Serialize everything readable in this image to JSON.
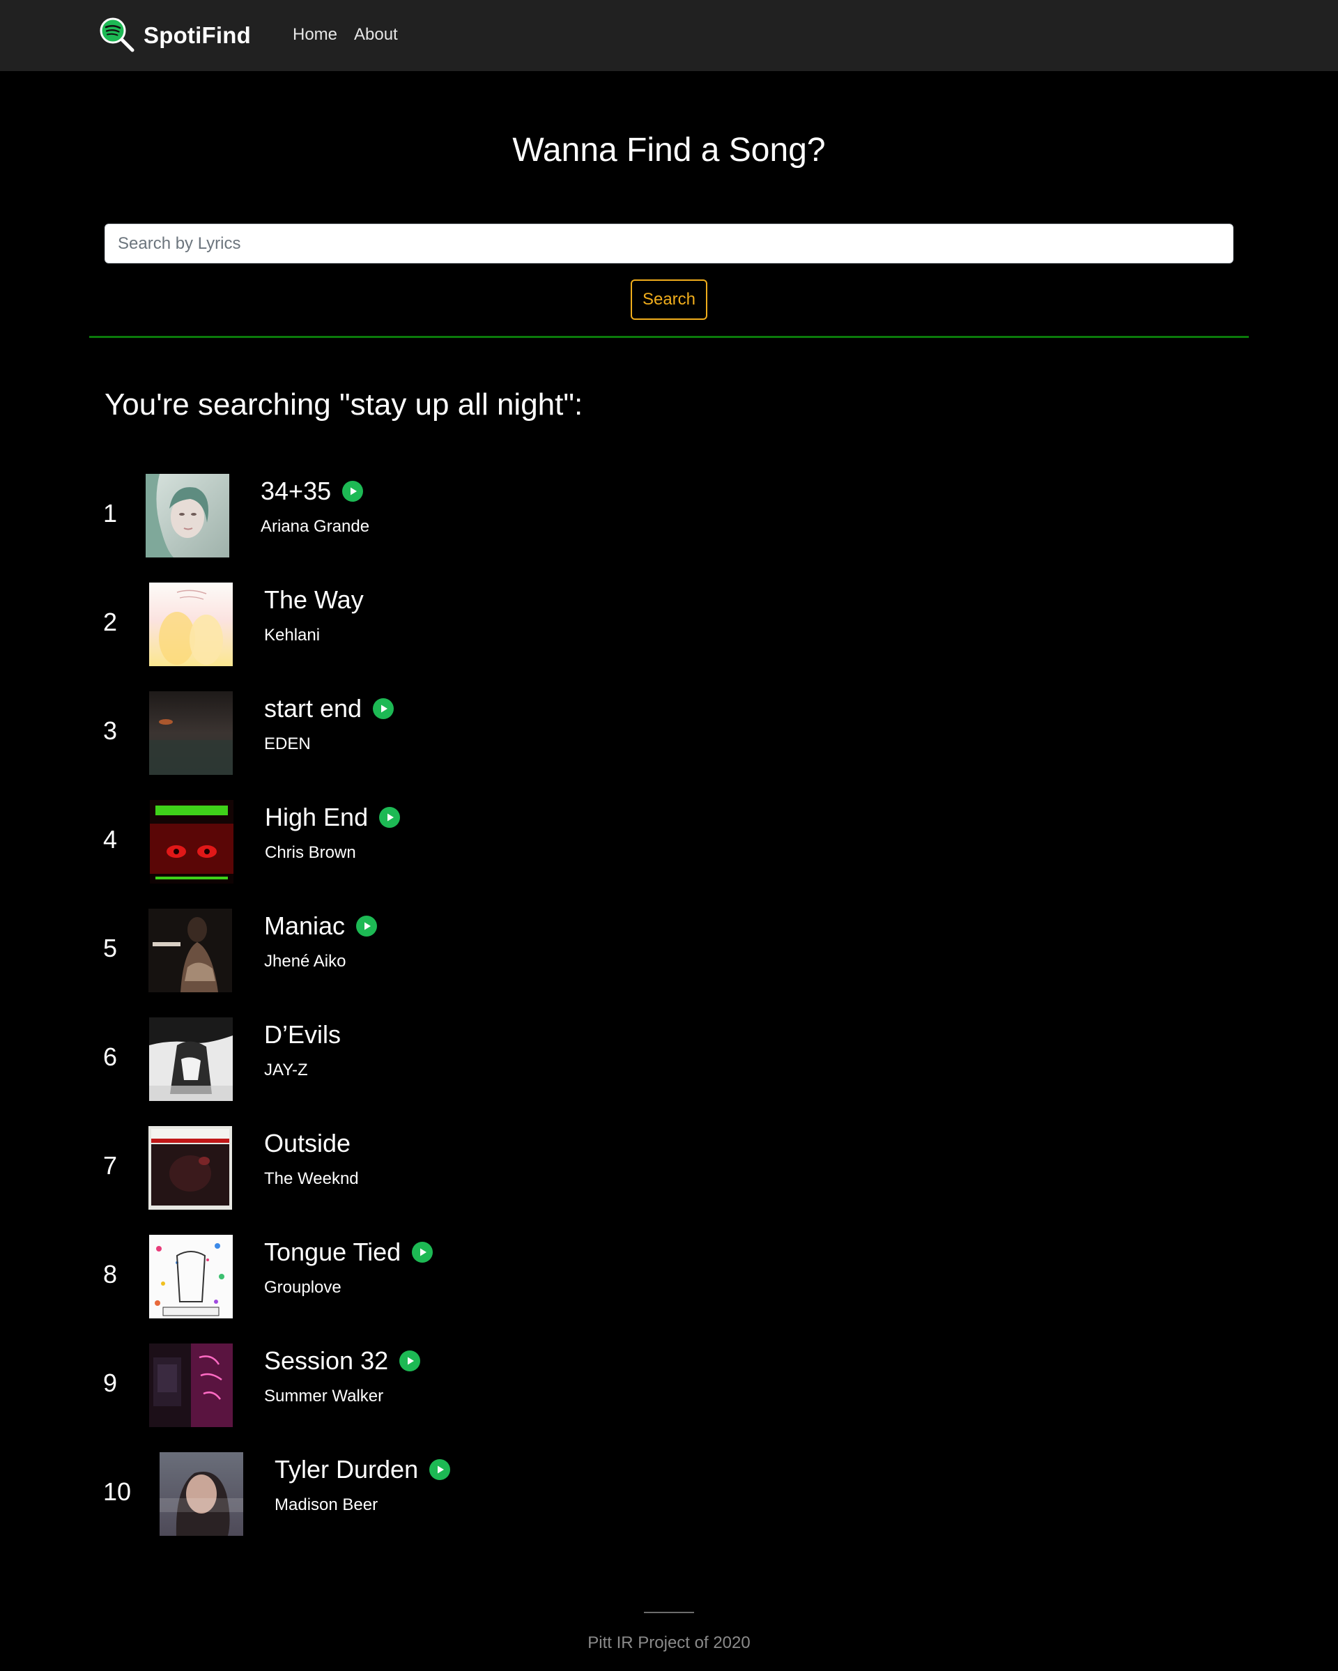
{
  "navbar": {
    "brand": "SpotiFind",
    "links": [
      {
        "label": "Home"
      },
      {
        "label": "About"
      }
    ]
  },
  "hero": {
    "title": "Wanna Find a Song?",
    "search_placeholder": "Search by Lyrics",
    "search_value": "",
    "search_button": "Search"
  },
  "results": {
    "heading": "You're searching \"stay up all night\":",
    "items": [
      {
        "rank": "1",
        "title": "34+35",
        "artist": "Ariana Grande",
        "has_preview": true
      },
      {
        "rank": "2",
        "title": "The Way",
        "artist": "Kehlani",
        "has_preview": false
      },
      {
        "rank": "3",
        "title": "start end",
        "artist": "EDEN",
        "has_preview": true
      },
      {
        "rank": "4",
        "title": "High End",
        "artist": "Chris Brown",
        "has_preview": true
      },
      {
        "rank": "5",
        "title": "Maniac",
        "artist": "Jhené Aiko",
        "has_preview": true
      },
      {
        "rank": "6",
        "title": "D’Evils",
        "artist": "JAY-Z",
        "has_preview": false
      },
      {
        "rank": "7",
        "title": "Outside",
        "artist": "The Weeknd",
        "has_preview": false
      },
      {
        "rank": "8",
        "title": "Tongue Tied",
        "artist": "Grouplove",
        "has_preview": true
      },
      {
        "rank": "9",
        "title": "Session 32",
        "artist": "Summer Walker",
        "has_preview": true
      },
      {
        "rank": "10",
        "title": "Tyler Durden",
        "artist": "Madison Beer",
        "has_preview": true
      }
    ]
  },
  "footer": {
    "text": "Pitt IR Project of 2020"
  },
  "colors": {
    "background": "#000000",
    "navbar": "#212121",
    "accent_green": "#1db954",
    "divider_green": "#0b7a0b",
    "search_button": "#f0ad1c",
    "footer_text": "#8a8a8a"
  },
  "icons": {
    "brand": "spotify-search-logo-icon",
    "play": "play-circle-icon"
  }
}
